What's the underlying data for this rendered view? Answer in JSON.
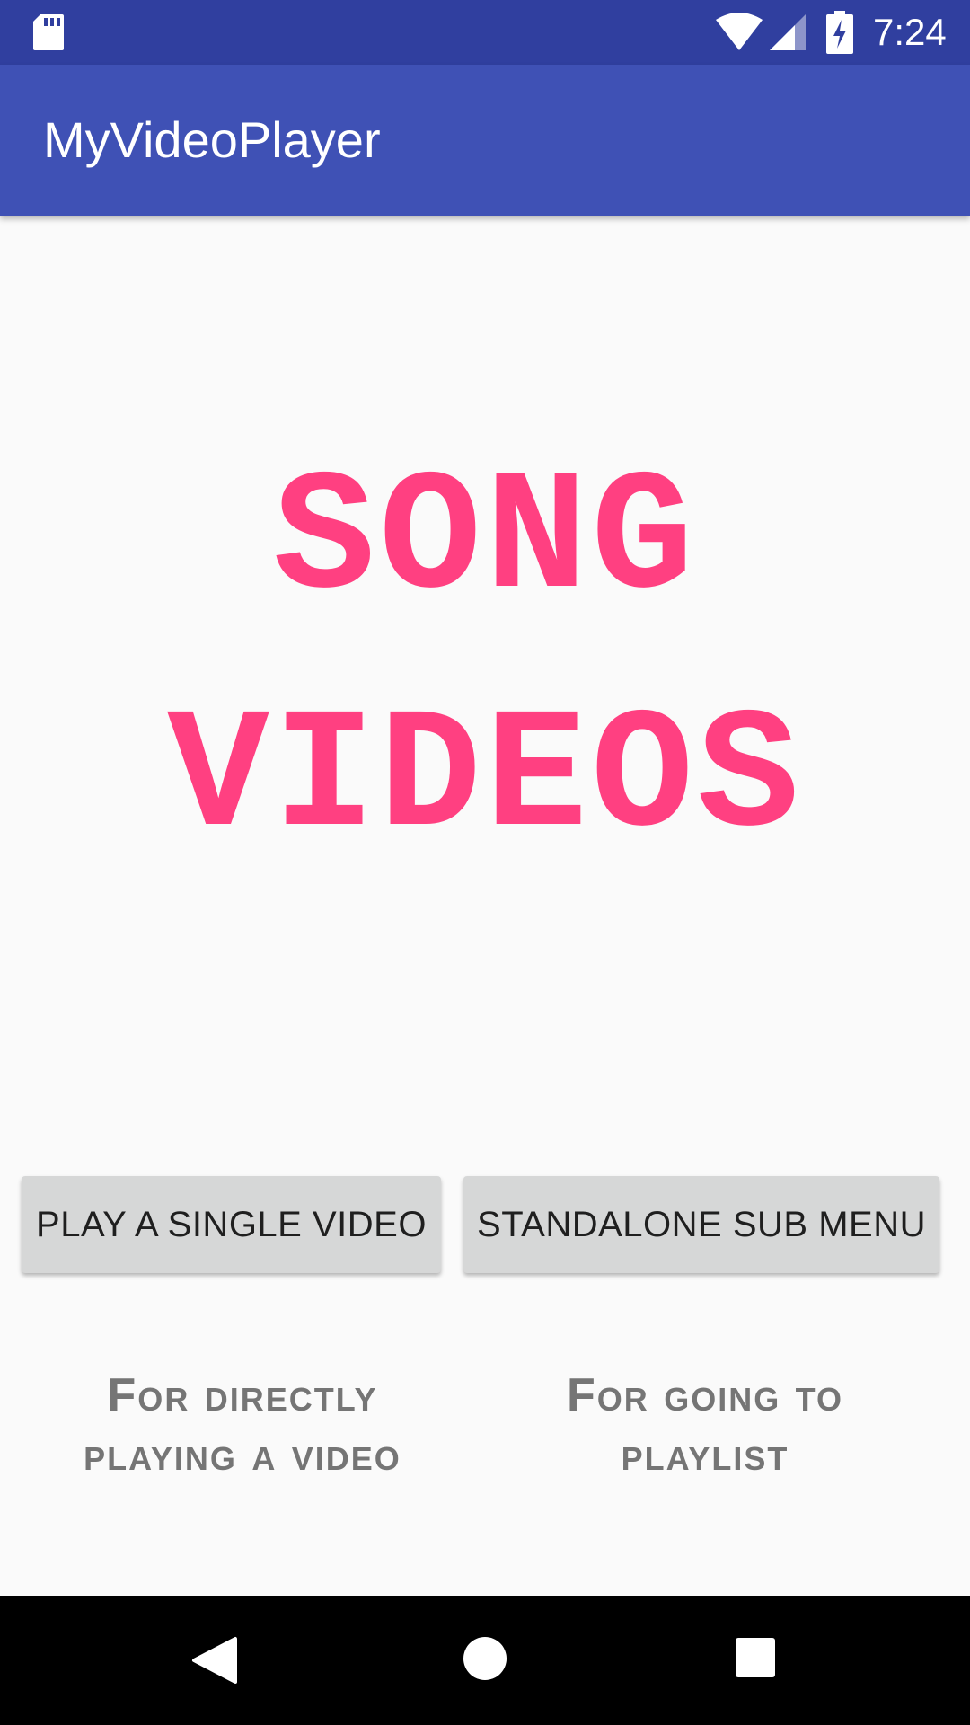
{
  "status_bar": {
    "time": "7:24",
    "icons": [
      "sd-card-icon",
      "wifi-icon",
      "cell-signal-icon",
      "battery-charging-icon"
    ]
  },
  "app_bar": {
    "title": "MyVideoPlayer"
  },
  "headline": {
    "line1": "SONG",
    "line2": "VIDEOS"
  },
  "buttons": {
    "single_video": "PLAY A SINGLE VIDEO",
    "sub_menu": "STANDALONE SUB MENU"
  },
  "captions": {
    "left_line1": "For directly",
    "left_line2": "playing a video",
    "right_line1": "For going to",
    "right_line2": "playlist"
  },
  "nav_bar": {
    "icons": [
      "back-icon",
      "home-icon",
      "recents-icon"
    ]
  },
  "colors": {
    "status_bar": "#303f9f",
    "app_bar": "#3f51b5",
    "accent": "#ff4081",
    "background": "#fafafa",
    "button": "#d6d7d7",
    "caption": "#757575"
  }
}
